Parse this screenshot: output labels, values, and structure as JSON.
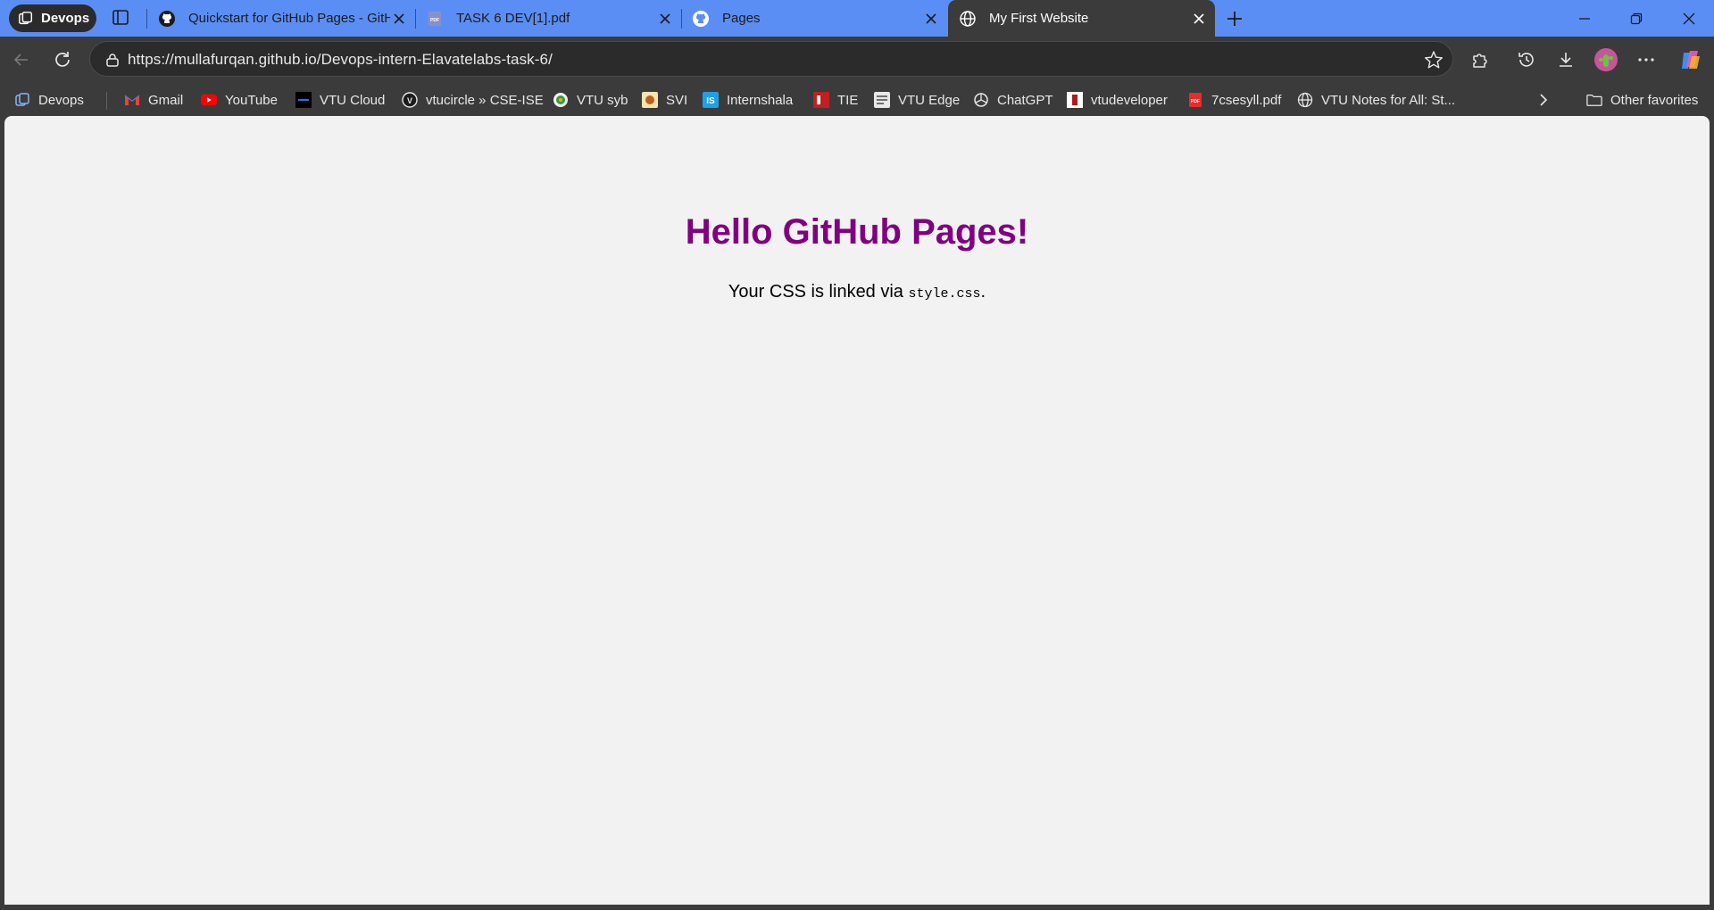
{
  "browser": {
    "profile_label": "Devops",
    "tabs": [
      {
        "title": "Quickstart for GitHub Pages - GitHub Docs",
        "favicon": "github-icon"
      },
      {
        "title": "TASK 6 DEV[1].pdf",
        "favicon": "pdf-icon"
      },
      {
        "title": "Pages",
        "favicon": "github-icon"
      },
      {
        "title": "My First Website",
        "favicon": "globe-icon",
        "active": true
      }
    ],
    "url": "https://mullafurqan.github.io/Devops-intern-Elavatelabs-task-6/"
  },
  "bookmarks": [
    {
      "label": "Devops",
      "icon": "workspace-icon"
    },
    {
      "label": "Gmail",
      "icon": "gmail-icon"
    },
    {
      "label": "YouTube",
      "icon": "youtube-icon"
    },
    {
      "label": "VTU Cloud",
      "icon": "vtu-cloud-icon"
    },
    {
      "label": "vtucircle » CSE-ISE",
      "icon": "vtucircle-icon"
    },
    {
      "label": "VTU syb",
      "icon": "vtu-syb-icon"
    },
    {
      "label": "SVI",
      "icon": "svi-icon"
    },
    {
      "label": "Internshala",
      "icon": "internshala-icon"
    },
    {
      "label": "TIE",
      "icon": "tie-icon"
    },
    {
      "label": "VTU Edge",
      "icon": "vtu-edge-icon"
    },
    {
      "label": "ChatGPT",
      "icon": "chatgpt-icon"
    },
    {
      "label": "vtudeveloper",
      "icon": "vtudeveloper-icon"
    },
    {
      "label": "7csesyll.pdf",
      "icon": "pdf-icon"
    },
    {
      "label": "VTU Notes for All: St...",
      "icon": "globe-icon"
    }
  ],
  "other_favorites": "Other favorites",
  "page": {
    "heading": "Hello GitHub Pages!",
    "text_before": "Your CSS is linked via ",
    "code": "style.css",
    "text_after": "."
  },
  "colors": {
    "tabstrip": "#5b8ef5",
    "chrome": "#3b3b3b",
    "page_background": "#f2f2f2",
    "heading": "#800080"
  }
}
